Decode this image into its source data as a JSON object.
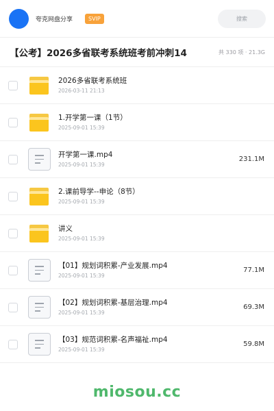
{
  "header": {
    "username": "夸克网盘分享",
    "badge": "SVIP",
    "search_placeholder": "搜索",
    "accent_color": "#1a73f5",
    "badge_color": "#f8a23a"
  },
  "folder_title": {
    "title": "【公考】2026多省联考系统班考前冲刺14",
    "meta": "共 330 项 · 21.3G"
  },
  "items": [
    {
      "type": "folder",
      "icon": "folder-icon",
      "name": "2026多省联考系统班",
      "date": "2026-03-11 21:13",
      "size": ""
    },
    {
      "type": "folder",
      "icon": "folder-icon",
      "name": "1.开学第一课（1节）",
      "date": "2025-09-01 15:39",
      "size": ""
    },
    {
      "type": "file",
      "icon": "video-file-icon",
      "name": "开学第一课.mp4",
      "date": "2025-09-01 15:39",
      "size": "231.1M"
    },
    {
      "type": "folder",
      "icon": "folder-icon",
      "name": "2.课前导学--申论（8节）",
      "date": "2025-09-01 15:39",
      "size": ""
    },
    {
      "type": "folder",
      "icon": "folder-icon",
      "name": "讲义",
      "date": "2025-09-01 15:39",
      "size": ""
    },
    {
      "type": "file",
      "icon": "video-file-icon",
      "name": "【01】规划词积累-产业发展.mp4",
      "date": "2025-09-01 15:39",
      "size": "77.1M"
    },
    {
      "type": "file",
      "icon": "video-file-icon",
      "name": "【02】规划词积累-基层治理.mp4",
      "date": "2025-09-01 15:39",
      "size": "69.3M"
    },
    {
      "type": "file",
      "icon": "video-file-icon",
      "name": "【03】规范词积累-名声福祉.mp4",
      "date": "2025-09-01 15:39",
      "size": "59.8M"
    }
  ],
  "watermark": "miosou.cc"
}
